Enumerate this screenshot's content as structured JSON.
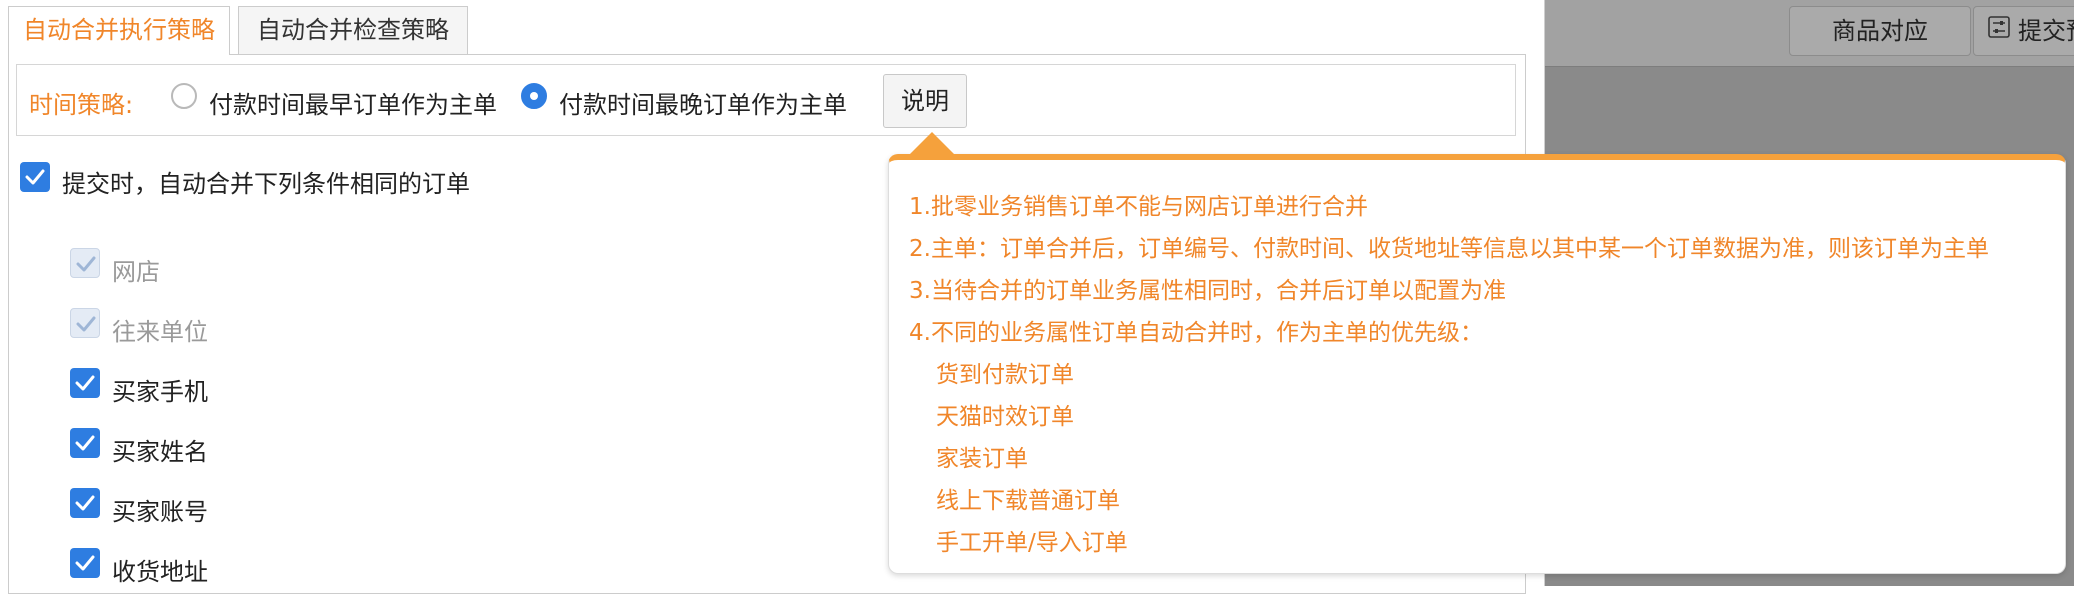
{
  "tabs": [
    {
      "label": "自动合并执行策略",
      "active": true
    },
    {
      "label": "自动合并检查策略",
      "active": false
    }
  ],
  "strategy": {
    "label": "时间策略:",
    "options": [
      {
        "label": "付款时间最早订单作为主单",
        "selected": false
      },
      {
        "label": "付款时间最晚订单作为主单",
        "selected": true
      }
    ],
    "explain_button": "说明"
  },
  "auto_merge": {
    "checked": true,
    "label": "提交时，自动合并下列条件相同的订单"
  },
  "conditions": [
    {
      "label": "网店",
      "checked": true,
      "disabled": true
    },
    {
      "label": "往来单位",
      "checked": true,
      "disabled": true
    },
    {
      "label": "买家手机",
      "checked": true,
      "disabled": false
    },
    {
      "label": "买家姓名",
      "checked": true,
      "disabled": false
    },
    {
      "label": "买家账号",
      "checked": true,
      "disabled": false
    },
    {
      "label": "收货地址",
      "checked": true,
      "disabled": false
    }
  ],
  "popover": {
    "lines": [
      "1.批零业务销售订单不能与网店订单进行合并",
      "2.主单：订单合并后，订单编号、付款时间、收货地址等信息以其中某一个订单数据为准，则该订单为主单",
      "3.当待合并的订单业务属性相同时，合并后订单以配置为准",
      "4.不同的业务属性订单自动合并时，作为主单的优先级："
    ],
    "priority_items": [
      "货到付款订单",
      "天猫时效订单",
      "家装订单",
      "线上下载普通订单",
      "手工开单/导入订单"
    ]
  },
  "background_toolbar": {
    "mapping_button": "商品对应",
    "submit_button": "提交预"
  },
  "colors": {
    "accent": "#f0862a",
    "popover_border": "#f5a13c",
    "checkbox": "#2e7de1"
  }
}
